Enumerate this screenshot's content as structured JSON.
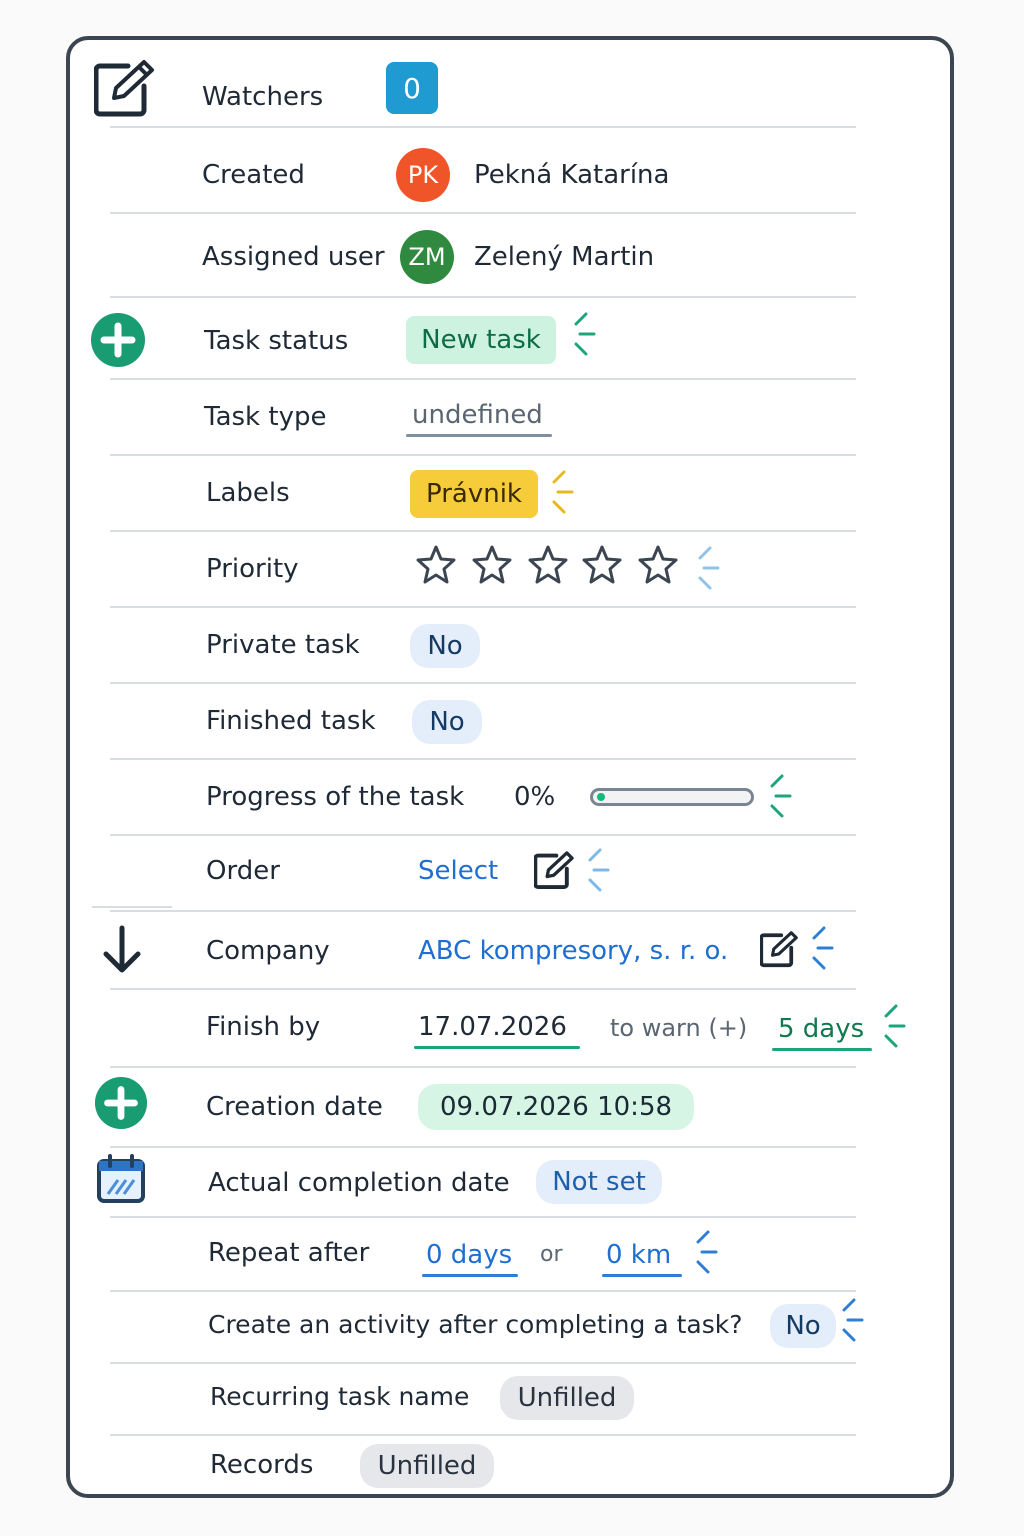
{
  "watchers": {
    "label": "Watchers",
    "count": "0"
  },
  "created": {
    "label": "Created",
    "initials": "PK",
    "name": "Pekná Katarína",
    "avatar_color": "#f0552a"
  },
  "assigned": {
    "label": "Assigned user",
    "initials": "ZM",
    "name": "Zelený Martin",
    "avatar_color": "#2f8a3f"
  },
  "task_status": {
    "label": "Task status",
    "value": "New task"
  },
  "task_type": {
    "label": "Task type",
    "value": "undefined"
  },
  "labels": {
    "label": "Labels",
    "value": "Právnik"
  },
  "priority": {
    "label": "Priority",
    "stars_total": 5,
    "stars_filled": 0
  },
  "private_task": {
    "label": "Private task",
    "value": "No"
  },
  "finished_task": {
    "label": "Finished task",
    "value": "No"
  },
  "progress": {
    "label": "Progress of the task",
    "value": "0%",
    "fraction": 0.0
  },
  "order": {
    "label": "Order",
    "value": "Select"
  },
  "company": {
    "label": "Company",
    "value": "ABC kompresory, s. r. o."
  },
  "finish_by": {
    "label": "Finish by",
    "date": "17.07.2026",
    "warn_label": "to warn (+)",
    "warn_value": "5 days"
  },
  "creation_date": {
    "label": "Creation date",
    "value": "09.07.2026 10:58"
  },
  "actual_completion": {
    "label": "Actual completion date",
    "value": "Not set"
  },
  "repeat_after": {
    "label": "Repeat after",
    "days": "0 days",
    "or": "or",
    "km": "0 km"
  },
  "create_activity": {
    "label": "Create an activity after completing a task?",
    "value": "No"
  },
  "recurring_name": {
    "label": "Recurring task name",
    "value": "Unfilled"
  },
  "records": {
    "label": "Records",
    "value": "Unfilled"
  },
  "colors": {
    "accent_green": "#1a9c73",
    "link_blue": "#1f6fd1",
    "label_yellow": "#f7cc3a",
    "badge_blue": "#1f9bd1"
  }
}
